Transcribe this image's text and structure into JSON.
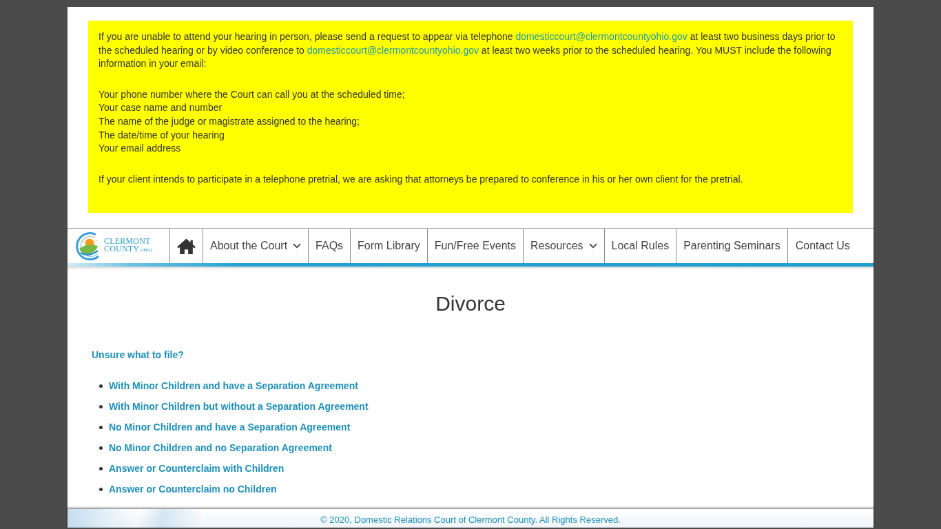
{
  "notice": {
    "intro": [
      {
        "kind": "text",
        "text": "If you are unable to attend your hearing in person, please send a request to appear via telephone "
      },
      {
        "kind": "link",
        "text": "domesticcourt@clermontcountyohio.gov"
      },
      {
        "kind": "text",
        "text": " at least two business days prior to the scheduled hearing or by video conference to "
      },
      {
        "kind": "link",
        "text": "domesticcourt@clermontcountyohio.gov"
      },
      {
        "kind": "text",
        "text": " at least two weeks prior to the scheduled hearing. You MUST include the following information in your email:"
      }
    ],
    "requirements": [
      "Your phone number where the Court can call you at the scheduled time;",
      "Your case name and number",
      "The name of the judge or magistrate assigned to the hearing;",
      "The date/time of your hearing",
      "Your email address"
    ],
    "closing": "If your client intends to participate in a telephone pretrial, we are asking that attorneys be prepared to conference in his or her own client for the pretrial."
  },
  "nav": {
    "logo": {
      "name": "CLERMONT",
      "county": "COUNTY",
      "state": "OHIO"
    },
    "items": [
      {
        "kind": "home"
      },
      {
        "kind": "link",
        "label": "About the Court",
        "dropdown": true
      },
      {
        "kind": "link",
        "label": "FAQs",
        "dropdown": false
      },
      {
        "kind": "link",
        "label": "Form Library",
        "dropdown": false
      },
      {
        "kind": "link",
        "label": "Fun/Free Events",
        "dropdown": false
      },
      {
        "kind": "link",
        "label": "Resources",
        "dropdown": true
      },
      {
        "kind": "link",
        "label": "Local Rules",
        "dropdown": false
      },
      {
        "kind": "link",
        "label": "Parenting Seminars",
        "dropdown": false
      },
      {
        "kind": "link",
        "label": "Contact Us",
        "dropdown": false
      }
    ]
  },
  "content": {
    "title": "Divorce",
    "prompt": "Unsure what to file?",
    "links": [
      "With Minor Children and have a Separation Agreement",
      "With Minor Children but without a Separation Agreement",
      "No Minor Children and have a Separation Agreement",
      "No Minor Children and no Separation Agreement",
      "Answer or Counterclaim with Children",
      "Answer or Counterclaim no Children"
    ]
  },
  "footer": {
    "copyright": "© 2020, Domestic Relations Court of Clermont County. All Rights Reserved."
  }
}
